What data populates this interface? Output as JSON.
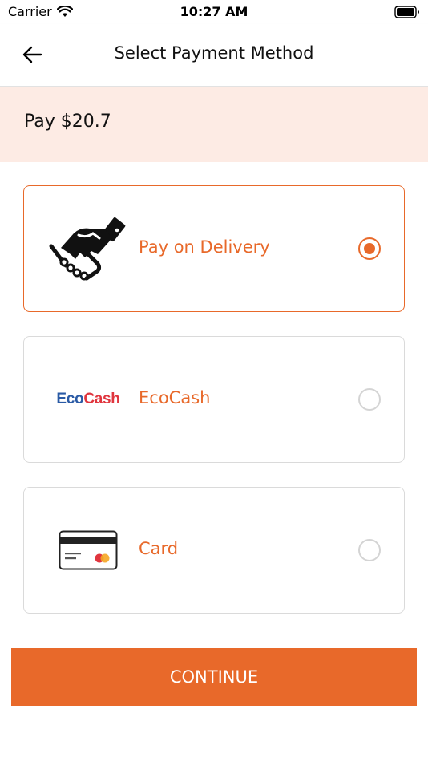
{
  "status_bar": {
    "carrier": "Carrier",
    "time": "10:27 AM"
  },
  "header": {
    "title": "Select Payment Method",
    "back_icon": "arrow-left-icon"
  },
  "payment": {
    "pay_text": "Pay $20.7"
  },
  "options": [
    {
      "label": "Pay on Delivery",
      "icon": "handshake-icon",
      "selected": true
    },
    {
      "label": "EcoCash",
      "icon": "ecocash-logo",
      "logo_eco": "Eco",
      "logo_cash": "Cash",
      "selected": false
    },
    {
      "label": "Card",
      "icon": "credit-card-icon",
      "selected": false
    }
  ],
  "footer": {
    "continue_label": "CONTINUE"
  },
  "colors": {
    "accent": "#e8692a",
    "banner_bg": "#fdebe4",
    "eco_blue": "#2a5aa5",
    "cash_red": "#e0353e"
  }
}
